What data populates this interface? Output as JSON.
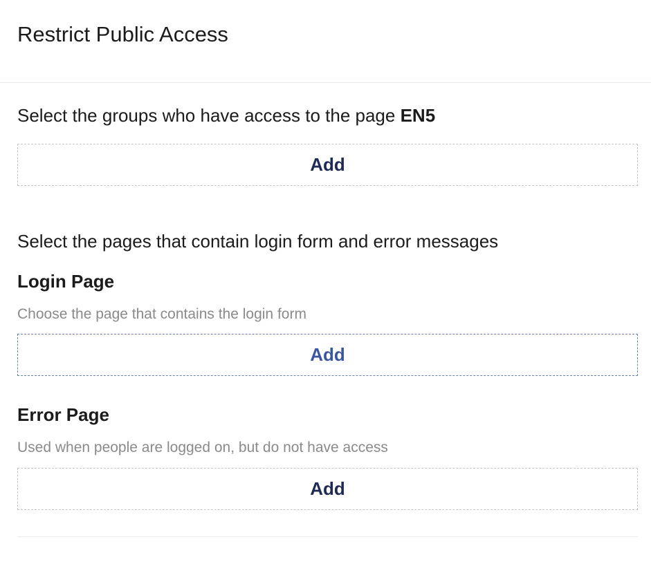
{
  "dialog": {
    "title": "Restrict Public Access"
  },
  "groups": {
    "intro_text": "Select the groups who have access to the page ",
    "page_name": "EN5",
    "add_label": "Add"
  },
  "pages": {
    "intro_text": "Select the pages that contain login form and error messages",
    "login_page": {
      "label": "Login Page",
      "description": "Choose the page that contains the login form",
      "add_label": "Add"
    },
    "error_page": {
      "label": "Error Page",
      "description": "Used when people are logged on, but do not have access",
      "add_label": "Add"
    }
  },
  "colors": {
    "add_text": "#1f2a55",
    "add_text_focused": "#3b56a0",
    "description_text": "#8a8a8a"
  }
}
